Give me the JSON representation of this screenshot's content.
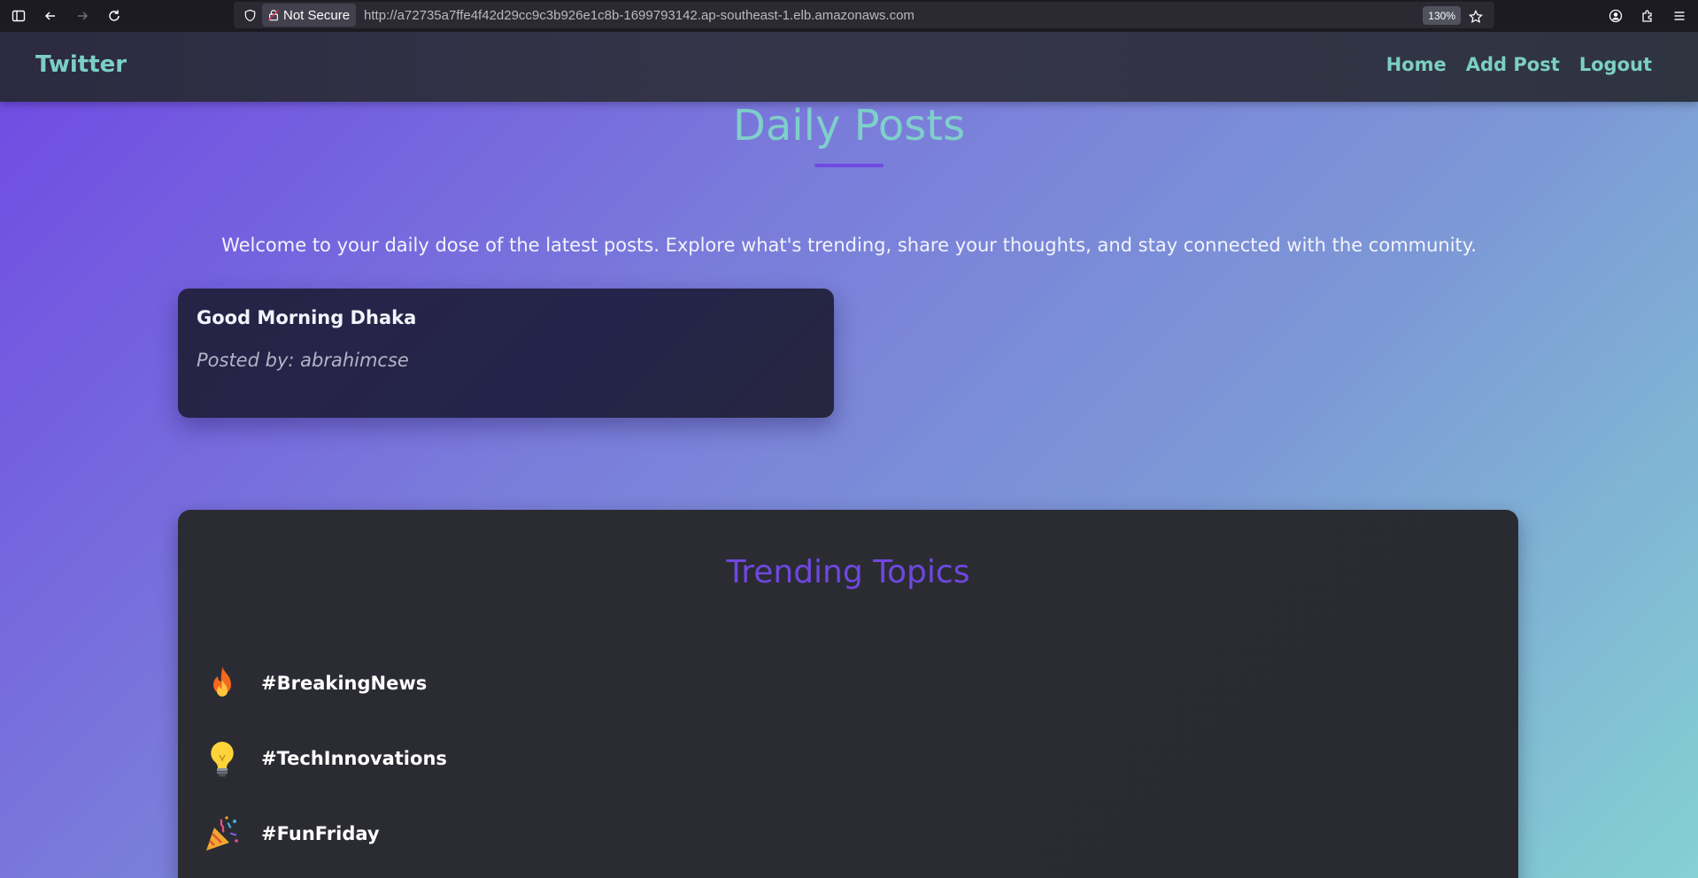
{
  "browser": {
    "security_label": "Not Secure",
    "url": "http://a72735a7ffe4f42d29cc9c3b926e1c8b-1699793142.ap-southeast-1.elb.amazonaws.com",
    "zoom": "130%"
  },
  "navbar": {
    "brand": "Twitter",
    "links": [
      {
        "label": "Home"
      },
      {
        "label": "Add Post"
      },
      {
        "label": "Logout"
      }
    ]
  },
  "main": {
    "title": "Daily Posts",
    "intro": "Welcome to your daily dose of the latest posts. Explore what's trending, share your thoughts, and stay connected with the community.",
    "posts": [
      {
        "title": "Good Morning Dhaka",
        "author": "Posted by: abrahimcse"
      }
    ]
  },
  "trending": {
    "title": "Trending Topics",
    "topics": [
      {
        "icon": "fire-icon",
        "label": "#BreakingNews"
      },
      {
        "icon": "lightbulb-icon",
        "label": "#TechInnovations"
      },
      {
        "icon": "party-popper-icon",
        "label": "#FunFriday"
      }
    ]
  },
  "colors": {
    "accent_teal": "#7ccfc5",
    "accent_purple": "#6f47e0",
    "navbar_bg": "#2f3042",
    "card_bg": "#25244a",
    "panel_bg": "#2b2c33"
  }
}
